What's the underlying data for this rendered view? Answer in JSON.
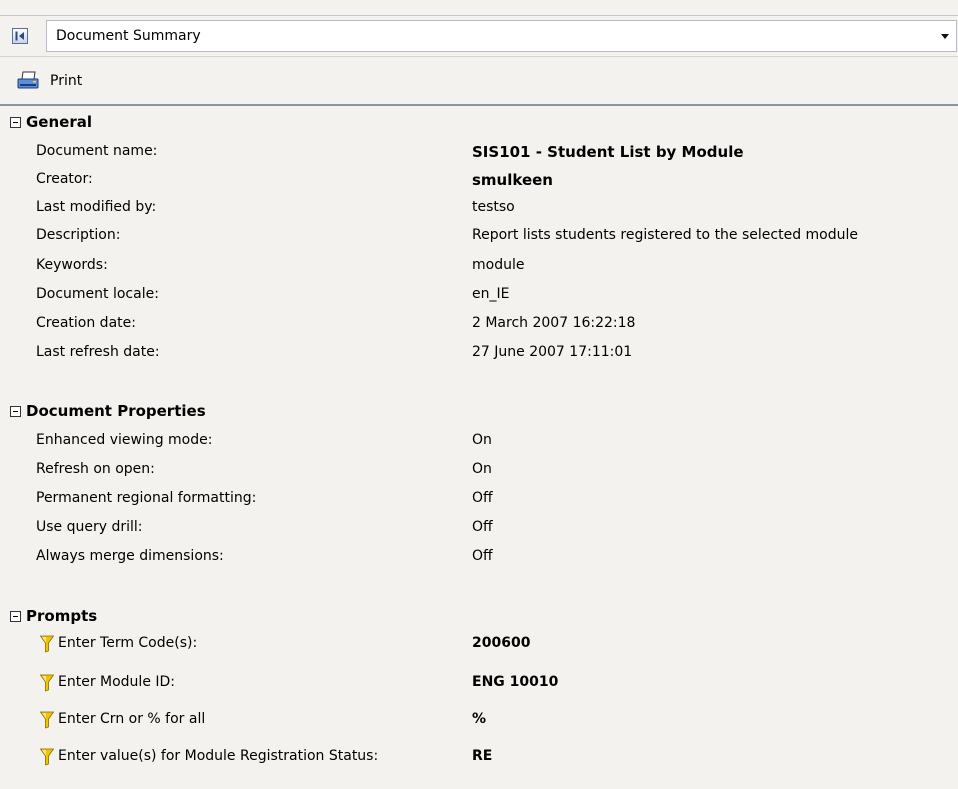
{
  "header": {
    "title": "Document Summary"
  },
  "toolbar": {
    "print_label": "Print"
  },
  "sections": {
    "general": {
      "title": "General",
      "rows": [
        {
          "label": "Document name:",
          "value": "SIS101 - Student List by Module"
        },
        {
          "label": "Creator:",
          "value": "smulkeen"
        },
        {
          "label": "Last modified by:",
          "value": "testso"
        },
        {
          "label": "Description:",
          "value": "Report lists students registered to the selected module"
        },
        {
          "label": "Keywords:",
          "value": "module"
        },
        {
          "label": "Document locale:",
          "value": "en_IE"
        },
        {
          "label": "Creation date:",
          "value": "2 March 2007 16:22:18"
        },
        {
          "label": "Last refresh date:",
          "value": "27 June 2007 17:11:01"
        }
      ]
    },
    "properties": {
      "title": "Document Properties",
      "rows": [
        {
          "label": "Enhanced viewing mode:",
          "value": "On"
        },
        {
          "label": "Refresh on open:",
          "value": "On"
        },
        {
          "label": "Permanent regional formatting:",
          "value": "Off"
        },
        {
          "label": "Use query drill:",
          "value": "Off"
        },
        {
          "label": "Always merge dimensions:",
          "value": "Off"
        }
      ]
    },
    "prompts": {
      "title": "Prompts",
      "rows": [
        {
          "label": "Enter Term Code(s):",
          "value": "200600"
        },
        {
          "label": "Enter Module ID:",
          "value": "ENG 10010"
        },
        {
          "label": "Enter Crn or % for all",
          "value": "%"
        },
        {
          "label": "Enter value(s) for Module Registration Status:",
          "value": "RE"
        }
      ]
    }
  },
  "icons": {
    "collapse": "collapse-panel-icon",
    "dropdown": "chevron-down-icon",
    "print": "printer-icon",
    "section_toggle": "minus-square-icon",
    "prompt": "filter-funnel-icon"
  },
  "colors": {
    "background": "#f3f2ee",
    "divider": "#8d93a6",
    "funnel": "#e0b000"
  }
}
